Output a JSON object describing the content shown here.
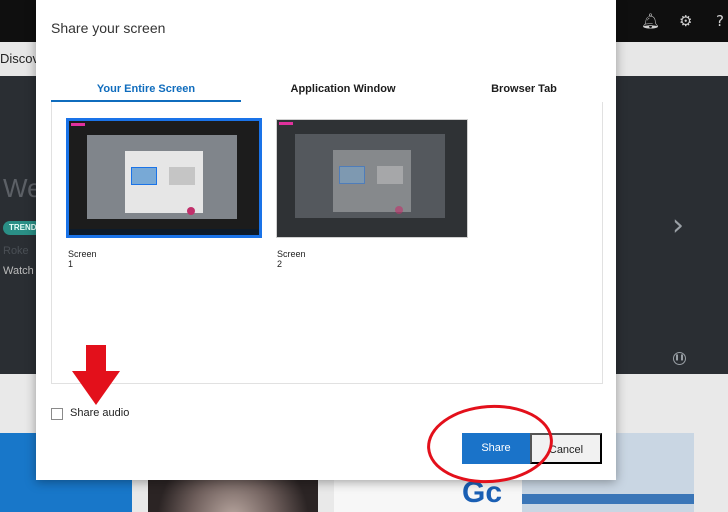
{
  "background_app": {
    "nav_text": "Discove",
    "hero_title": "We",
    "trend_badge": "TREND",
    "hero_subtitle": "Roke",
    "hero_watch": "Watch",
    "tile_text": "Gc",
    "icons": [
      "bell-icon",
      "gear-icon",
      "help-icon",
      "chevron-right-icon",
      "pause-icon"
    ]
  },
  "dialog": {
    "title": "Share your screen",
    "tabs": [
      {
        "label": "Your Entire Screen",
        "active": true
      },
      {
        "label": "Application Window",
        "active": false
      },
      {
        "label": "Browser Tab",
        "active": false
      }
    ],
    "screens": [
      {
        "label": "Screen 1",
        "selected": true
      },
      {
        "label": "Screen 2",
        "selected": false
      }
    ],
    "share_audio": {
      "label": "Share audio",
      "checked": false
    },
    "buttons": {
      "share": "Share",
      "cancel": "Cancel"
    }
  },
  "colors": {
    "accent": "#0f6cbd",
    "share_button": "#1a73c9",
    "annotation_red": "#e3101b"
  },
  "annotations": [
    "down-arrow-annotation",
    "circle-annotation"
  ]
}
